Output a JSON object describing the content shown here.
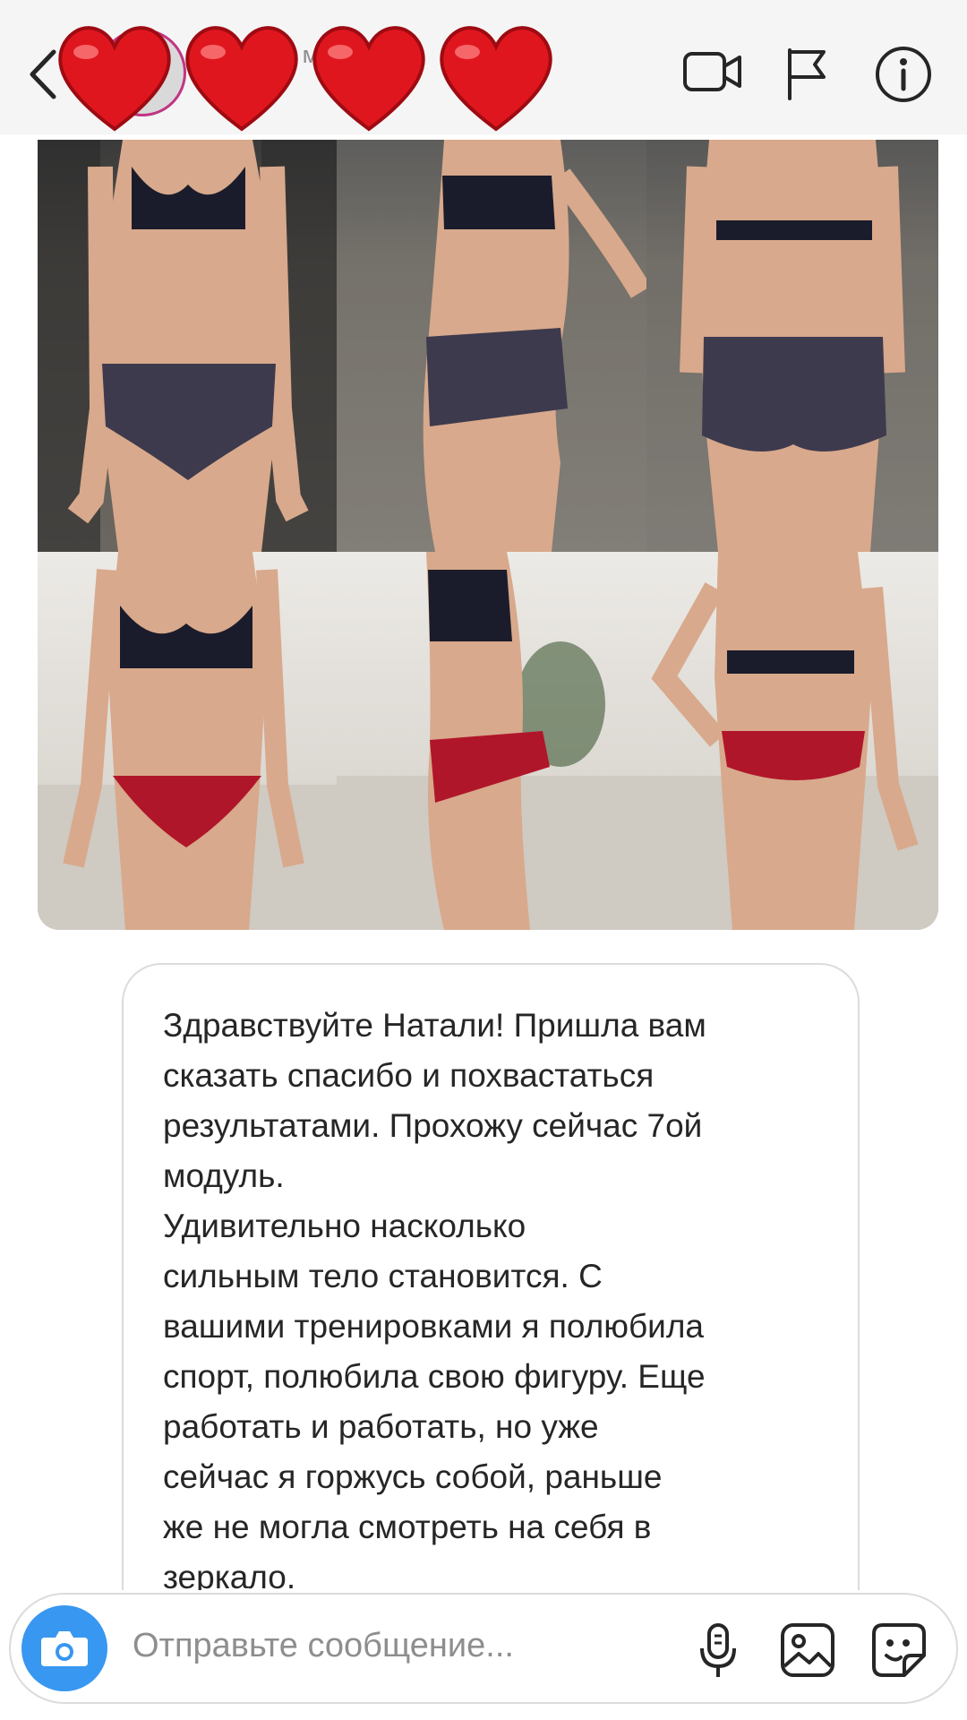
{
  "header": {
    "username": "",
    "status": "В сети 57 мин. назад",
    "icons": [
      "back-chevron-icon",
      "video-call-icon",
      "flag-icon",
      "info-icon"
    ],
    "stickers": [
      "heart-sticker",
      "heart-sticker",
      "heart-sticker",
      "heart-sticker"
    ]
  },
  "message": {
    "text": "Здравствуйте Натали! Пришла вам\nсказать спасибо и похвастаться\nрезультатами. Прохожу сейчас 7ой\nмодуль.\nУдивительно насколько\nсильным тело становится. С\nвашими тренировками я полюбила\nспорт, полюбила свою фигуру. Еще\nработать и работать, но уже\nсейчас я горжусь собой, раньше\nже не могла смотреть на себя в\nзеркало."
  },
  "photos": {
    "count": 6,
    "rows": 2,
    "columns": 3
  },
  "composer": {
    "placeholder": "Отправьте сообщение...",
    "icons": [
      "camera-icon",
      "microphone-icon",
      "gallery-icon",
      "sticker-icon"
    ]
  },
  "colors": {
    "accent": "#3897f0",
    "heart": "#e0161f",
    "header_bg": "#f5f5f5",
    "border": "#dbdbdb"
  }
}
